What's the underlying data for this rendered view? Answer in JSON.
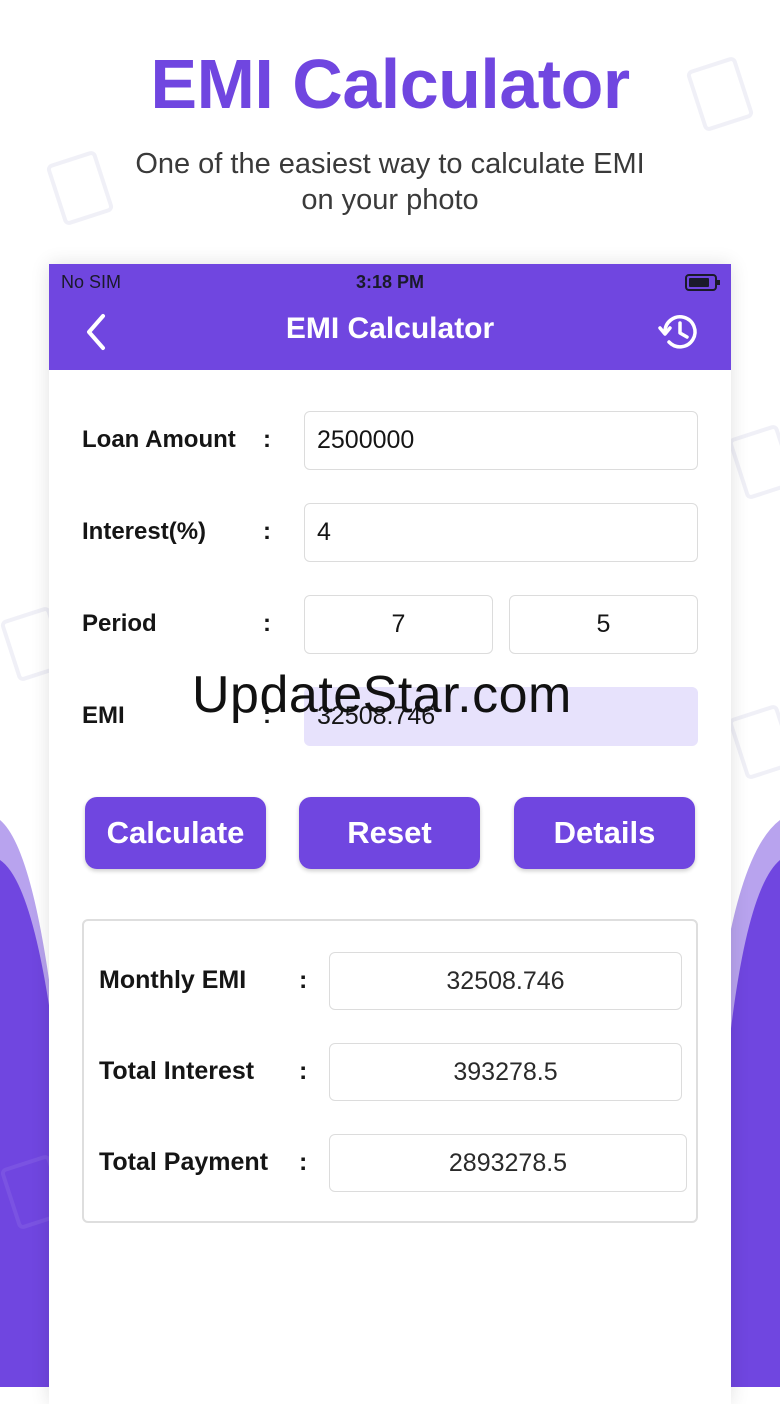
{
  "promo": {
    "title": "EMI Calculator",
    "subtitle": "One of the easiest way to calculate EMI on your photo"
  },
  "status_bar": {
    "carrier": "No SIM",
    "time": "3:18 PM"
  },
  "nav": {
    "title": "EMI Calculator",
    "back_icon": "chevron-left-icon",
    "history_icon": "history-icon"
  },
  "form": {
    "loan_amount": {
      "label": "Loan Amount",
      "colon": ":",
      "value": "2500000"
    },
    "interest": {
      "label": "Interest(%)",
      "colon": ":",
      "value": "4"
    },
    "period": {
      "label": "Period",
      "colon": ":",
      "years": "7",
      "months": "5"
    },
    "emi": {
      "label": "EMI",
      "colon": ":",
      "value": "32508.746"
    }
  },
  "buttons": {
    "calculate": "Calculate",
    "reset": "Reset",
    "details": "Details"
  },
  "results": {
    "monthly_emi": {
      "label": "Monthly EMI",
      "colon": ":",
      "value": "32508.746"
    },
    "total_interest": {
      "label": "Total Interest",
      "colon": ":",
      "value": "393278.5"
    },
    "total_payment": {
      "label": "Total Payment",
      "colon": ":",
      "value": "2893278.5"
    }
  },
  "watermark": "UpdateStar.com",
  "colors": {
    "accent": "#7046e0",
    "emi_field_bg": "#e7e2fc",
    "text": "#151515"
  }
}
